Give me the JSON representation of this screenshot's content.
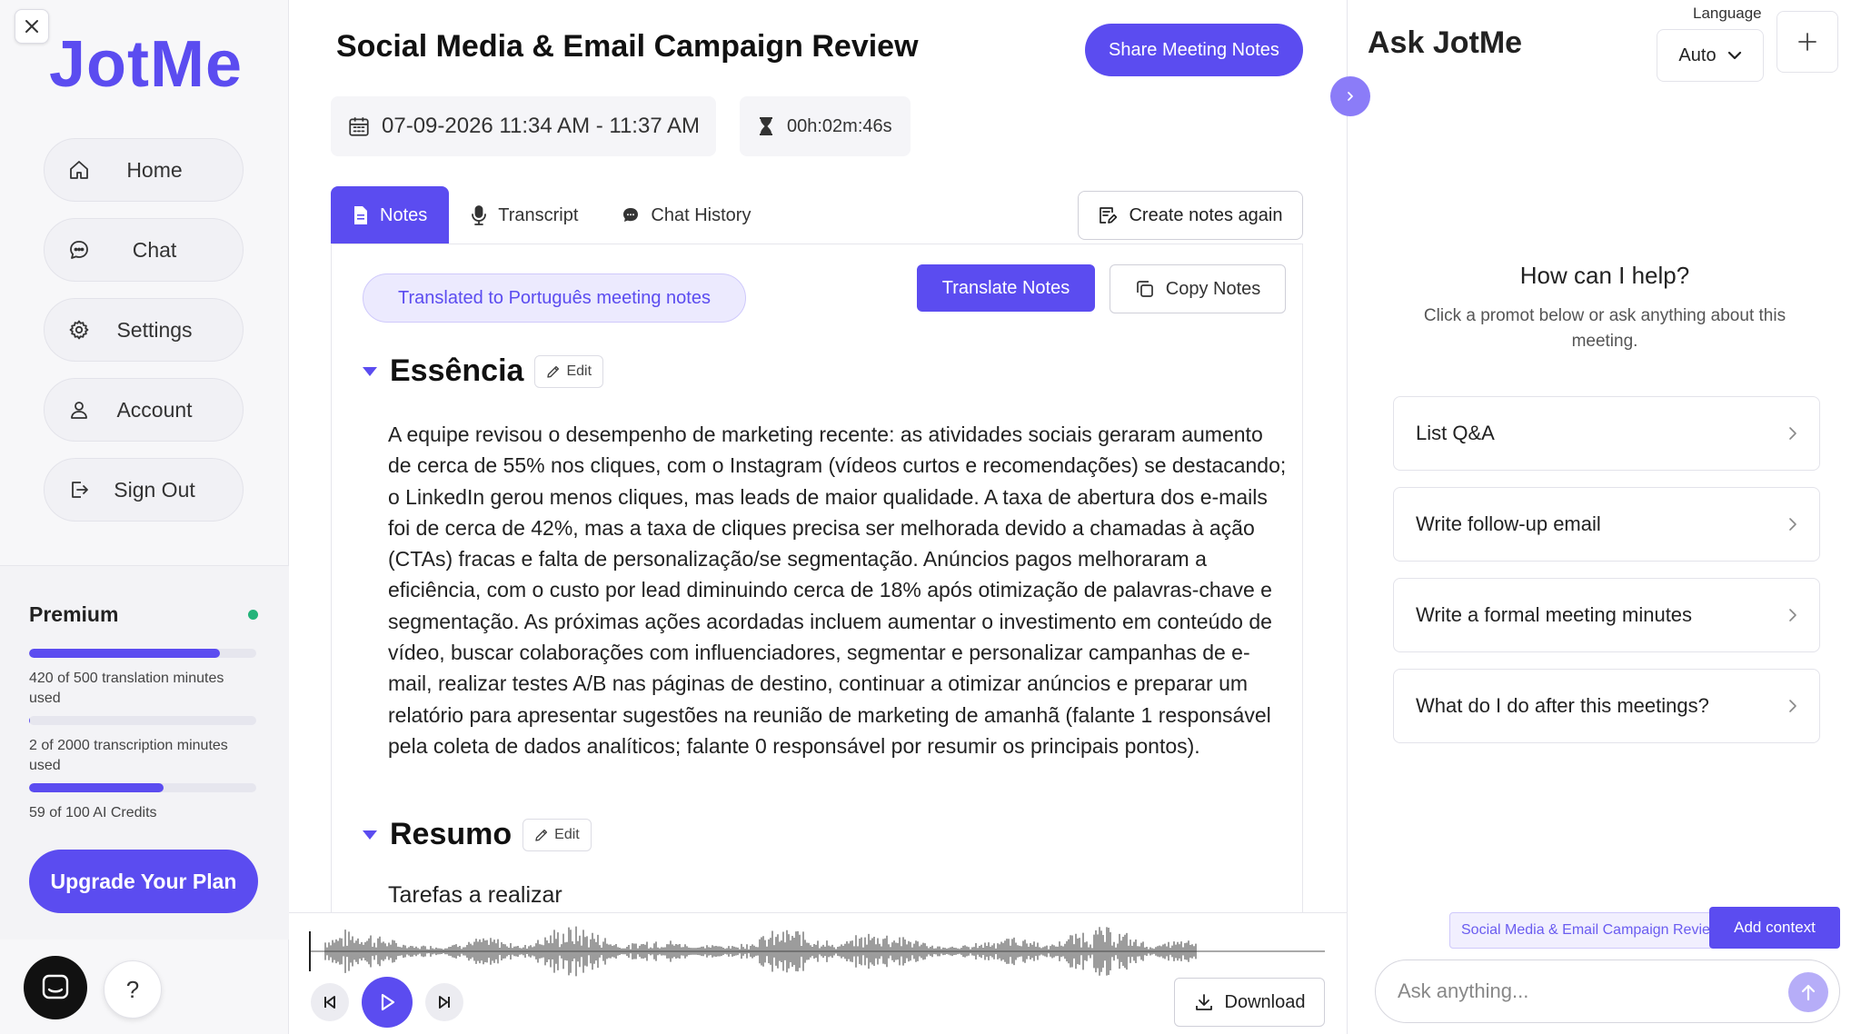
{
  "sidebar": {
    "logo": "JotMe",
    "nav": [
      {
        "label": "Home",
        "icon": "home-icon"
      },
      {
        "label": "Chat",
        "icon": "chat-icon"
      },
      {
        "label": "Settings",
        "icon": "gear-icon"
      },
      {
        "label": "Account",
        "icon": "user-icon"
      },
      {
        "label": "Sign Out",
        "icon": "sign-out-icon"
      }
    ],
    "plan": {
      "name": "Premium",
      "translation_usage": "420 of 500 translation minutes used",
      "translation_used": 420,
      "translation_total": 500,
      "transcription_usage": "2 of 2000 transcription minutes used",
      "transcription_used": 2,
      "transcription_total": 2000,
      "ai_usage": "59 of 100 AI Credits",
      "ai_used": 59,
      "ai_total": 100,
      "upgrade_label": "Upgrade Your Plan"
    },
    "help_label": "?"
  },
  "meeting": {
    "title": "Social Media & Email Campaign Review",
    "share_label": "Share Meeting Notes",
    "datetime": "07-09-2026 11:34 AM - 11:37 AM",
    "duration": "00h:02m:46s"
  },
  "tabs": [
    {
      "label": "Notes",
      "icon": "document-icon",
      "active": true
    },
    {
      "label": "Transcript",
      "icon": "microphone-icon",
      "active": false
    },
    {
      "label": "Chat History",
      "icon": "chat-icon",
      "active": false
    }
  ],
  "actions": {
    "recreate_label": "Create notes again",
    "translate_label": "Translate Notes",
    "copy_label": "Copy Notes"
  },
  "notes": {
    "translated_badge": "Translated to Português meeting notes",
    "edit_label": "Edit",
    "essencia_title": "Essência",
    "essencia_text": "A equipe revisou o desempenho de marketing recente: as atividades sociais geraram aumento de cerca de 55% nos cliques, com o Instagram (vídeos curtos e recomendações) se destacando; o LinkedIn gerou menos cliques, mas leads de maior qualidade. A taxa de abertura dos e-mails foi de cerca de 42%, mas a taxa de cliques precisa ser melhorada devido a chamadas à ação (CTAs) fracas e falta de personalização/se segmentação. Anúncios pagos melhoraram a eficiência, com o custo por lead diminuindo cerca de 18% após otimização de palavras-chave e segmentação. As próximas ações acordadas incluem aumentar o investimento em conteúdo de vídeo, buscar colaborações com influenciadores, segmentar e personalizar campanhas de e-mail, realizar testes A/B nas páginas de destino, continuar a otimizar anúncios e preparar um relatório para apresentar sugestões na reunião de marketing de amanhã (falante 1 responsável pela coleta de dados analíticos; falante 0 responsável por resumir os principais pontos).",
    "resumo_title": "Resumo",
    "resumo_sub": "Tarefas a realizar"
  },
  "player": {
    "download_label": "Download"
  },
  "ask": {
    "title": "Ask JotMe",
    "language_label": "Language",
    "language_value": "Auto",
    "help_title": "How can I help?",
    "help_sub": "Click a promot below or ask anything about this meeting.",
    "prompts": [
      "List Q&A",
      "Write follow-up email",
      "Write a formal meeting minutes",
      "What do I do after this meetings?"
    ],
    "context_chip": "Social Media & Email Campaign Review",
    "add_context_label": "Add context",
    "input_placeholder": "Ask anything..."
  },
  "colors": {
    "accent": "#5b4cf0",
    "status_online": "#23b37a"
  }
}
